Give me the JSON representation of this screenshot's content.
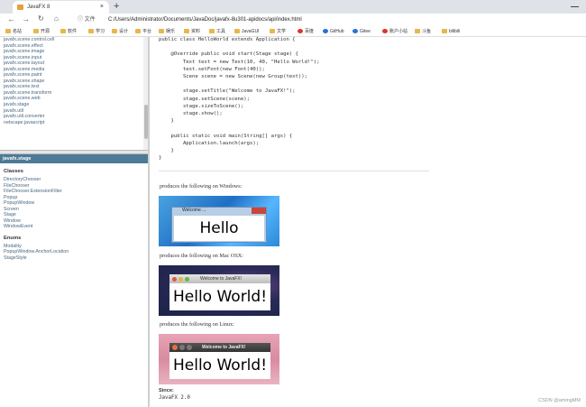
{
  "browser": {
    "tab_title": "JavaFX 8",
    "new_tab": "+",
    "close_tab": "×",
    "doc_label": "文件",
    "url": "C:/Users/Administrator/Documents/JavaDoc/javafx-8u301-apidocs/api/index.html"
  },
  "bookmarks": [
    "名站",
    "开源",
    "软件",
    "学习",
    "设计",
    "平台",
    "娱乐",
    "资料",
    "工具",
    "JavaGUI",
    "文学",
    "百度",
    "GitHub",
    "Gitee",
    "账户小站",
    "斗鱼",
    "bilibili"
  ],
  "left": {
    "packages": [
      "javafx.scene.control.cell",
      "javafx.scene.effect",
      "javafx.scene.image",
      "javafx.scene.input",
      "javafx.scene.layout",
      "javafx.scene.media",
      "javafx.scene.paint",
      "javafx.scene.shape",
      "javafx.scene.text",
      "javafx.scene.transform",
      "javafx.scene.web",
      "javafx.stage",
      "javafx.util",
      "javafx.util.converter",
      "netscape.javascript"
    ],
    "package_header": "javafx.stage",
    "classes_heading": "Classes",
    "classes": [
      "DirectoryChooser",
      "FileChooser",
      "FileChooser.ExtensionFilter",
      "Popup",
      "PopupWindow",
      "Screen",
      "Stage",
      "Window",
      "WindowEvent"
    ],
    "enums_heading": "Enums",
    "enums": [
      "Modality",
      "PopupWindow.AnchorLocation",
      "StageStyle"
    ]
  },
  "content": {
    "code": "public class HelloWorld extends Application {\n\n    @Override public void start(Stage stage) {\n        Text text = new Text(10, 40, \"Hello World!\");\n        text.setFont(new Font(40));\n        Scene scene = new Scene(new Group(text));\n\n        stage.setTitle(\"Welcome to JavaFX!\");\n        stage.setScene(scene);\n        stage.sizeToScene();\n        stage.show();\n    }\n\n    public static void main(String[] args) {\n        Application.launch(args);\n    }\n}",
    "windows_caption": "produces the following on Windows:",
    "mac_caption": "produces the following on Mac OSX:",
    "linux_caption": "produces the following on Linux:",
    "windows_title": "Welcome ...",
    "mac_title": "Welcome to JavaFX!",
    "linux_title": "Welcome to JavaFX!",
    "hello": "Hello World!",
    "since_label": "Since:",
    "since_value": "JavaFX 2.0"
  },
  "watermark": "CSDN @amingMM"
}
